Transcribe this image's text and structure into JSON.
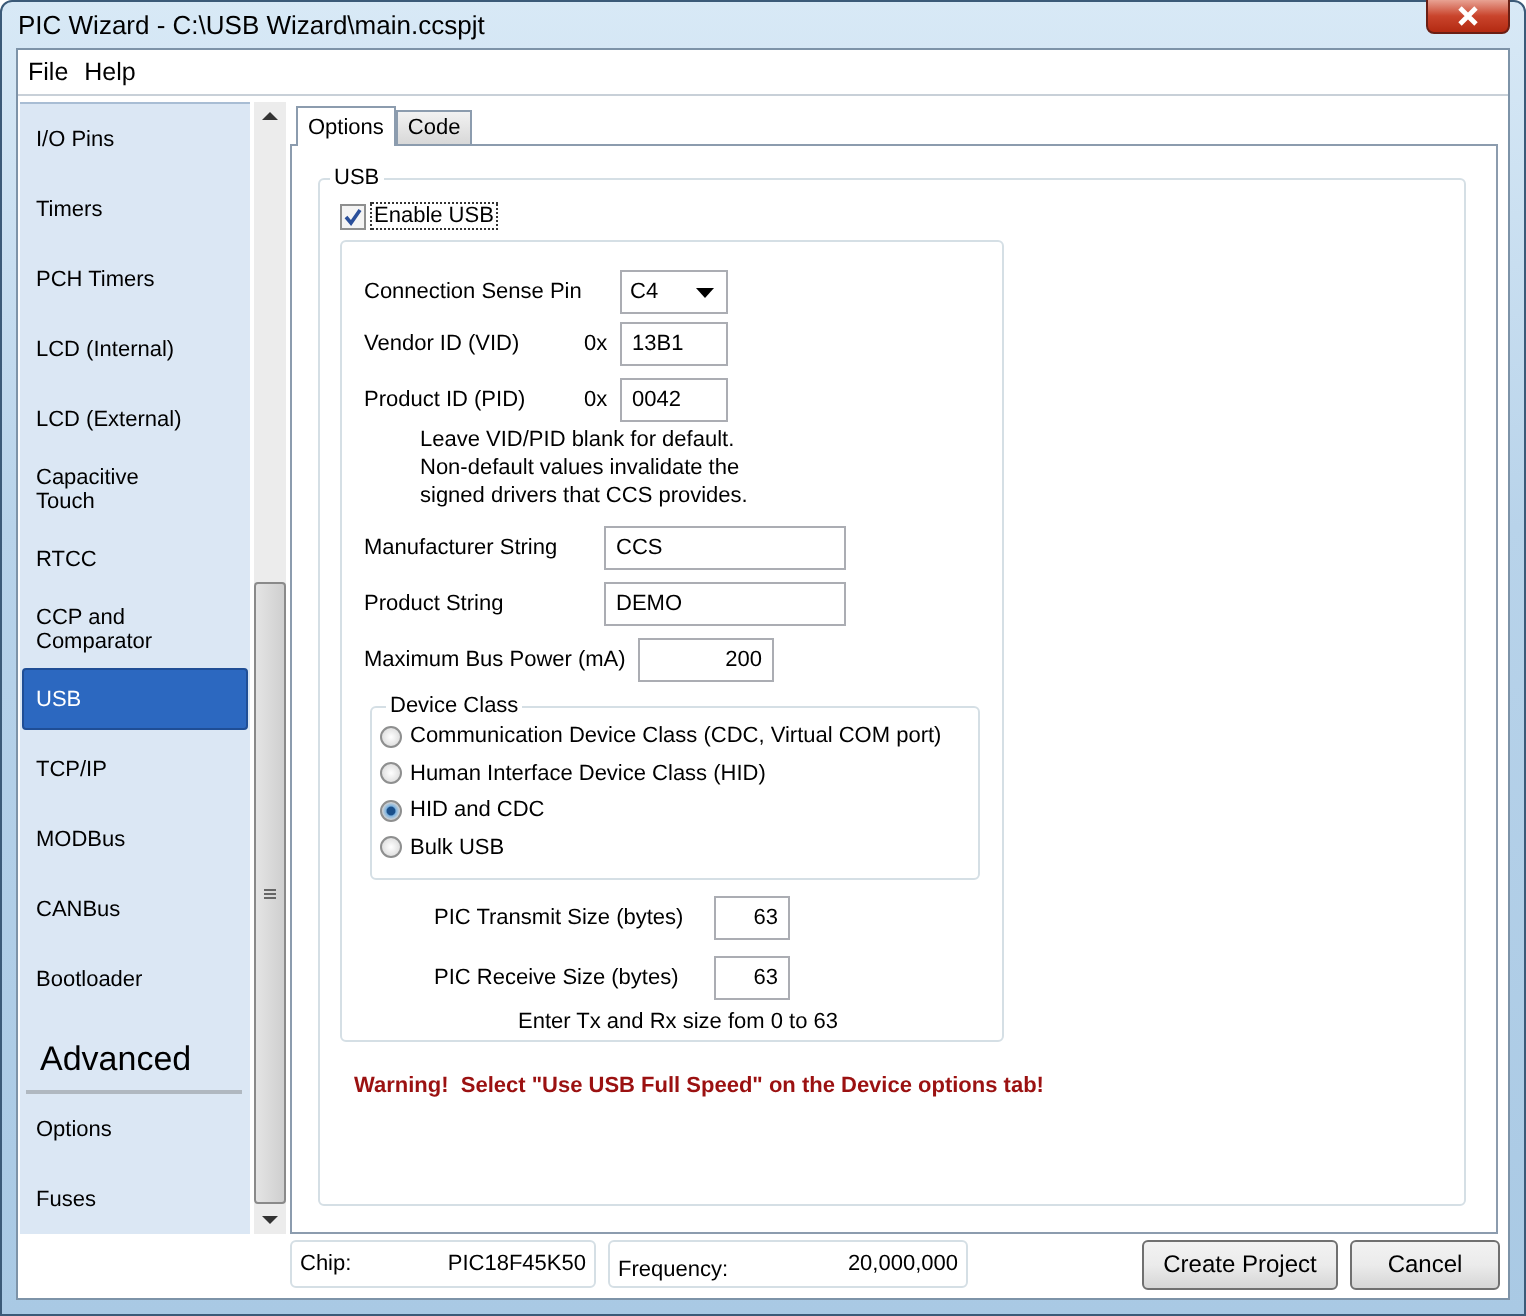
{
  "window": {
    "title": "PIC Wizard - C:\\USB Wizard\\main.ccspjt"
  },
  "menu": [
    "File",
    "Help"
  ],
  "sidebar": {
    "items": [
      {
        "label": "I/O Pins",
        "kind": "item",
        "selected": false
      },
      {
        "label": "Timers",
        "kind": "item",
        "selected": false
      },
      {
        "label": "PCH Timers",
        "kind": "item",
        "selected": false
      },
      {
        "label": "LCD (Internal)",
        "kind": "item",
        "selected": false
      },
      {
        "label": "LCD (External)",
        "kind": "item",
        "selected": false
      },
      {
        "label": "Capacitive Touch",
        "kind": "item",
        "selected": false
      },
      {
        "label": "RTCC",
        "kind": "item",
        "selected": false
      },
      {
        "label": "CCP and Comparator",
        "kind": "item",
        "selected": false
      },
      {
        "label": "USB",
        "kind": "item",
        "selected": true
      },
      {
        "label": "TCP/IP",
        "kind": "item",
        "selected": false
      },
      {
        "label": "MODBus",
        "kind": "item",
        "selected": false
      },
      {
        "label": "CANBus",
        "kind": "item",
        "selected": false
      },
      {
        "label": "Bootloader",
        "kind": "item",
        "selected": false
      },
      {
        "label": "Advanced",
        "kind": "heading"
      },
      {
        "label": "Options",
        "kind": "item",
        "selected": false
      },
      {
        "label": "Fuses",
        "kind": "item",
        "selected": false
      }
    ]
  },
  "tabs": [
    {
      "label": "Options",
      "selected": true
    },
    {
      "label": "Code",
      "selected": false
    }
  ],
  "usb": {
    "title": "USB",
    "enable": {
      "label": "Enable USB",
      "checked": true
    },
    "sense_pin": {
      "label": "Connection Sense Pin",
      "value": "C4"
    },
    "vendor_id": {
      "label": "Vendor ID (VID)",
      "prefix": "0x",
      "value": "13B1"
    },
    "product_id": {
      "label": "Product ID (PID)",
      "prefix": "0x",
      "value": "0042"
    },
    "id_note": "Leave VID/PID blank for default.\nNon-default values invalidate the\nsigned drivers that CCS provides.",
    "manufacturer": {
      "label": "Manufacturer String",
      "value": "CCS"
    },
    "product": {
      "label": "Product String",
      "value": "DEMO"
    },
    "bus_power": {
      "label": "Maximum Bus Power (mA)",
      "value": "200"
    },
    "device_class": {
      "title": "Device Class",
      "options": [
        {
          "label": "Communication Device Class (CDC, Virtual COM port)",
          "selected": false
        },
        {
          "label": "Human Interface Device Class (HID)",
          "selected": false
        },
        {
          "label": "HID and CDC",
          "selected": true
        },
        {
          "label": "Bulk USB",
          "selected": false
        }
      ]
    },
    "transmit": {
      "label": "PIC Transmit Size (bytes)",
      "value": "63"
    },
    "receive": {
      "label": "PIC Receive Size (bytes)",
      "value": "63"
    },
    "size_note": "Enter Tx and Rx size fom 0 to 63"
  },
  "warning": "Warning!  Select \"Use USB Full Speed\" on the Device options tab!",
  "status": {
    "chip": {
      "label": "Chip:",
      "value": "PIC18F45K50"
    },
    "frequency": {
      "label": "Frequency:",
      "value": "20,000,000"
    }
  },
  "buttons": [
    "Create Project",
    "Cancel"
  ]
}
